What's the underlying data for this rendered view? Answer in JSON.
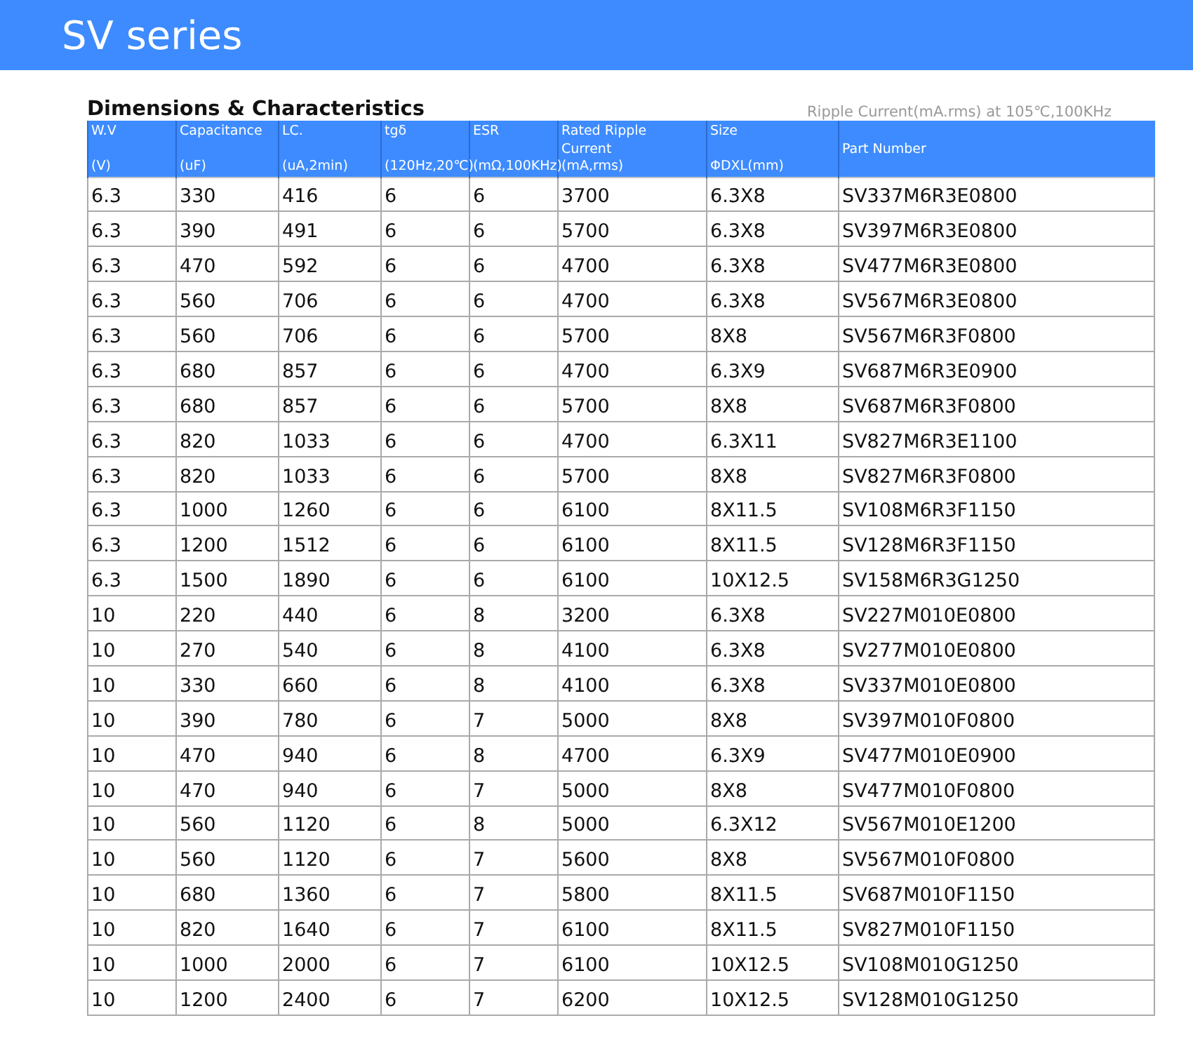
{
  "banner": {
    "title": "SV series"
  },
  "section": {
    "title": "Dimensions & Characteristics",
    "note": "Ripple Current(mA.rms) at 105℃,100KHz"
  },
  "table": {
    "columns": [
      {
        "lines": [
          "W.V",
          "(V)"
        ]
      },
      {
        "lines": [
          "Capacitance",
          "(uF)"
        ]
      },
      {
        "lines": [
          "LC.",
          "(uA,2min)"
        ]
      },
      {
        "lines": [
          "tgδ",
          "(120Hz,20℃)"
        ]
      },
      {
        "lines": [
          "ESR",
          "(mΩ,100KHz)"
        ]
      },
      {
        "lines": [
          "Rated Ripple",
          "Current",
          "(mA,rms)"
        ]
      },
      {
        "lines": [
          "Size",
          "ΦDXL(mm)"
        ]
      },
      {
        "lines": [
          "Part Number"
        ]
      }
    ],
    "rows": [
      [
        "6.3",
        "330",
        "416",
        "6",
        "6",
        "3700",
        "6.3X8",
        "SV337M6R3E0800"
      ],
      [
        "6.3",
        "390",
        "491",
        "6",
        "6",
        "5700",
        "6.3X8",
        "SV397M6R3E0800"
      ],
      [
        "6.3",
        "470",
        "592",
        "6",
        "6",
        "4700",
        "6.3X8",
        "SV477M6R3E0800"
      ],
      [
        "6.3",
        "560",
        "706",
        "6",
        "6",
        "4700",
        "6.3X8",
        "SV567M6R3E0800"
      ],
      [
        "6.3",
        "560",
        "706",
        "6",
        "6",
        "5700",
        "8X8",
        "SV567M6R3F0800"
      ],
      [
        "6.3",
        "680",
        "857",
        "6",
        "6",
        "4700",
        "6.3X9",
        "SV687M6R3E0900"
      ],
      [
        "6.3",
        "680",
        "857",
        "6",
        "6",
        "5700",
        "8X8",
        "SV687M6R3F0800"
      ],
      [
        "6.3",
        "820",
        "1033",
        "6",
        "6",
        "4700",
        "6.3X11",
        "SV827M6R3E1100"
      ],
      [
        "6.3",
        "820",
        "1033",
        "6",
        "6",
        "5700",
        "8X8",
        "SV827M6R3F0800"
      ],
      [
        "6.3",
        "1000",
        "1260",
        "6",
        "6",
        "6100",
        "8X11.5",
        "SV108M6R3F1150"
      ],
      [
        "6.3",
        "1200",
        "1512",
        "6",
        "6",
        "6100",
        "8X11.5",
        "SV128M6R3F1150"
      ],
      [
        "6.3",
        "1500",
        "1890",
        "6",
        "6",
        "6100",
        "10X12.5",
        "SV158M6R3G1250"
      ],
      [
        "10",
        "220",
        "440",
        "6",
        "8",
        "3200",
        "6.3X8",
        "SV227M010E0800"
      ],
      [
        "10",
        "270",
        "540",
        "6",
        "8",
        "4100",
        "6.3X8",
        "SV277M010E0800"
      ],
      [
        "10",
        "330",
        "660",
        "6",
        "8",
        "4100",
        "6.3X8",
        "SV337M010E0800"
      ],
      [
        "10",
        "390",
        "780",
        "6",
        "7",
        "5000",
        "8X8",
        "SV397M010F0800"
      ],
      [
        "10",
        "470",
        "940",
        "6",
        "8",
        "4700",
        "6.3X9",
        "SV477M010E0900"
      ],
      [
        "10",
        "470",
        "940",
        "6",
        "7",
        "5000",
        "8X8",
        "SV477M010F0800"
      ],
      [
        "10",
        "560",
        "1120",
        "6",
        "8",
        "5000",
        "6.3X12",
        "SV567M010E1200"
      ],
      [
        "10",
        "560",
        "1120",
        "6",
        "7",
        "5600",
        "8X8",
        "SV567M010F0800"
      ],
      [
        "10",
        "680",
        "1360",
        "6",
        "7",
        "5800",
        "8X11.5",
        "SV687M010F1150"
      ],
      [
        "10",
        "820",
        "1640",
        "6",
        "7",
        "6100",
        "8X11.5",
        "SV827M010F1150"
      ],
      [
        "10",
        "1000",
        "2000",
        "6",
        "7",
        "6100",
        "10X12.5",
        "SV108M010G1250"
      ],
      [
        "10",
        "1200",
        "2400",
        "6",
        "7",
        "6200",
        "10X12.5",
        "SV128M010G1250"
      ]
    ]
  }
}
